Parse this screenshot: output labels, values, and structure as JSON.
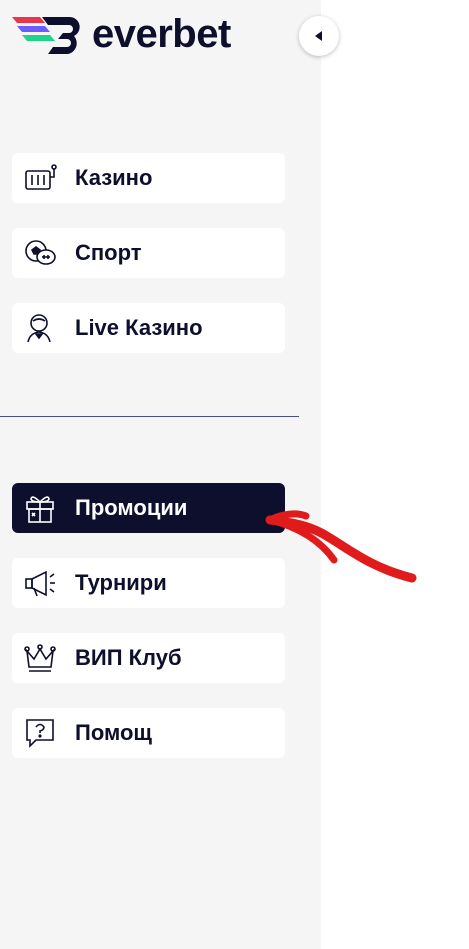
{
  "brand": {
    "name": "everbet",
    "colors": {
      "navy": "#0d0f2c",
      "green": "#1fd38a",
      "red": "#e8354c",
      "purple": "#6a5cff"
    }
  },
  "sidebar": {
    "collapse_icon": "triangle-left-icon",
    "items": [
      {
        "label": "Казино",
        "icon": "slot-machine-icon",
        "active": false
      },
      {
        "label": "Спорт",
        "icon": "sports-balls-icon",
        "active": false
      },
      {
        "label": "Live Казино",
        "icon": "dealer-icon",
        "active": false
      },
      {
        "label": "Промоции",
        "icon": "gift-icon",
        "active": true
      },
      {
        "label": "Турнири",
        "icon": "megaphone-icon",
        "active": false
      },
      {
        "label": "ВИП Клуб",
        "icon": "crown-icon",
        "active": false
      },
      {
        "label": "Помощ",
        "icon": "help-chat-icon",
        "active": false
      }
    ]
  },
  "annotation": {
    "color": "#e01b1b"
  }
}
